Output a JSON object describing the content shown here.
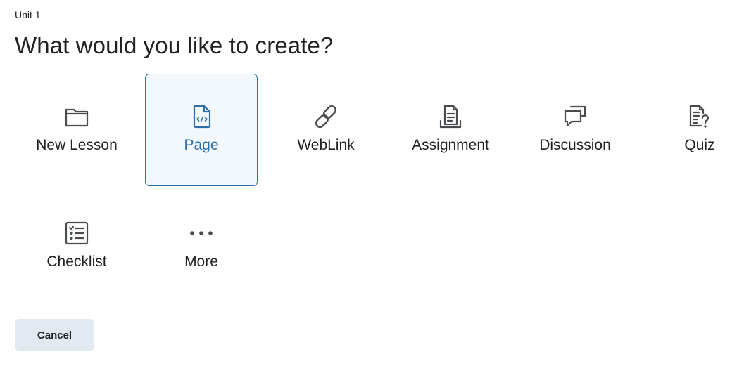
{
  "breadcrumb": "Unit 1",
  "title": "What would you like to create?",
  "options": [
    {
      "label": "New Lesson",
      "icon": "folder-icon"
    },
    {
      "label": "Page",
      "icon": "html-file-icon",
      "selected": true
    },
    {
      "label": "WebLink",
      "icon": "link-icon"
    },
    {
      "label": "Assignment",
      "icon": "assignment-icon"
    },
    {
      "label": "Discussion",
      "icon": "discussion-icon"
    },
    {
      "label": "Quiz",
      "icon": "quiz-icon"
    },
    {
      "label": "Checklist",
      "icon": "checklist-icon"
    },
    {
      "label": "More",
      "icon": "more-dots-icon"
    }
  ],
  "actions": {
    "cancel_label": "Cancel"
  },
  "colors": {
    "accent": "#2f6fa9",
    "selected_bg": "#f3f8fd",
    "text": "#202122",
    "icon": "#494c4e",
    "button_bg": "#e3e9f1"
  }
}
